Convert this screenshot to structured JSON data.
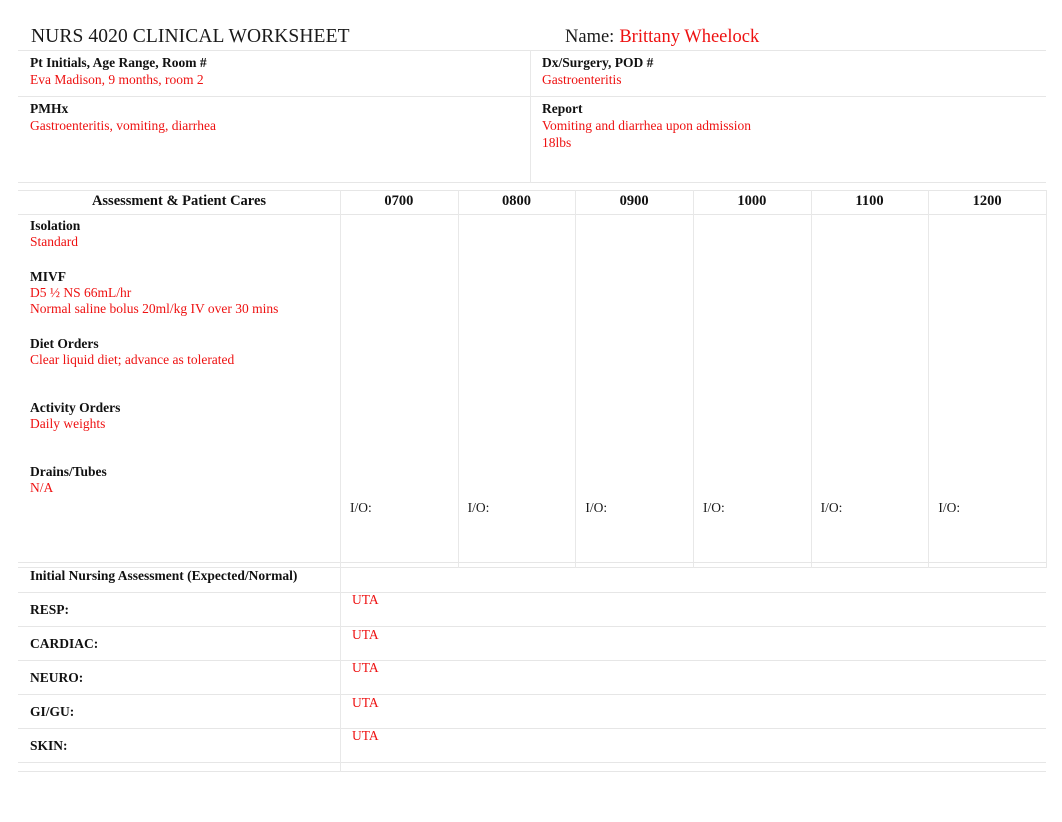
{
  "document": {
    "title": "NURS 4020 CLINICAL WORKSHEET",
    "name_label": "Name:",
    "name_value": "Brittany Wheelock"
  },
  "header": {
    "pt_initials": {
      "label": "Pt Initials, Age Range, Room #",
      "value": "Eva Madison, 9 months, room 2"
    },
    "dx_surgery": {
      "label": "Dx/Surgery, POD #",
      "value": "Gastroenteritis"
    },
    "pmhx": {
      "label": "PMHx",
      "value": "Gastroenteritis, vomiting, diarrhea"
    },
    "report": {
      "label": "Report",
      "value_line1": "Vomiting and diarrhea upon admission",
      "value_line2": "18lbs"
    }
  },
  "table": {
    "first_col_header": "Assessment &  Patient Cares",
    "time_columns": [
      "0700",
      "0800",
      "0900",
      "1000",
      "1100",
      "1200"
    ],
    "io_label": "I/O:",
    "cares": [
      {
        "label": "Isolation",
        "values": [
          "Standard"
        ]
      },
      {
        "label": "MIVF",
        "values": [
          "D5 ½ NS 66mL/hr",
          "Normal saline bolus 20ml/kg IV over 30 mins"
        ]
      },
      {
        "label": "Diet Orders",
        "values": [
          "Clear liquid diet; advance as tolerated"
        ]
      },
      {
        "label": "Activity Orders",
        "values": [
          "Daily weights"
        ]
      },
      {
        "label": "Drains/Tubes",
        "values": [
          "N/A"
        ]
      }
    ]
  },
  "nursing_assessment": {
    "title": "Initial Nursing Assessment (Expected/Normal)",
    "rows": [
      {
        "label": "RESP:",
        "value": "UTA"
      },
      {
        "label": "CARDIAC:",
        "value": "UTA"
      },
      {
        "label": "NEURO:",
        "value": "UTA"
      },
      {
        "label": "GI/GU:",
        "value": "UTA"
      },
      {
        "label": "SKIN:",
        "value": "UTA"
      }
    ]
  },
  "colors": {
    "entry_red": "#ee1111",
    "label_black": "#111111",
    "grid_gray": "#e6e6e6"
  }
}
